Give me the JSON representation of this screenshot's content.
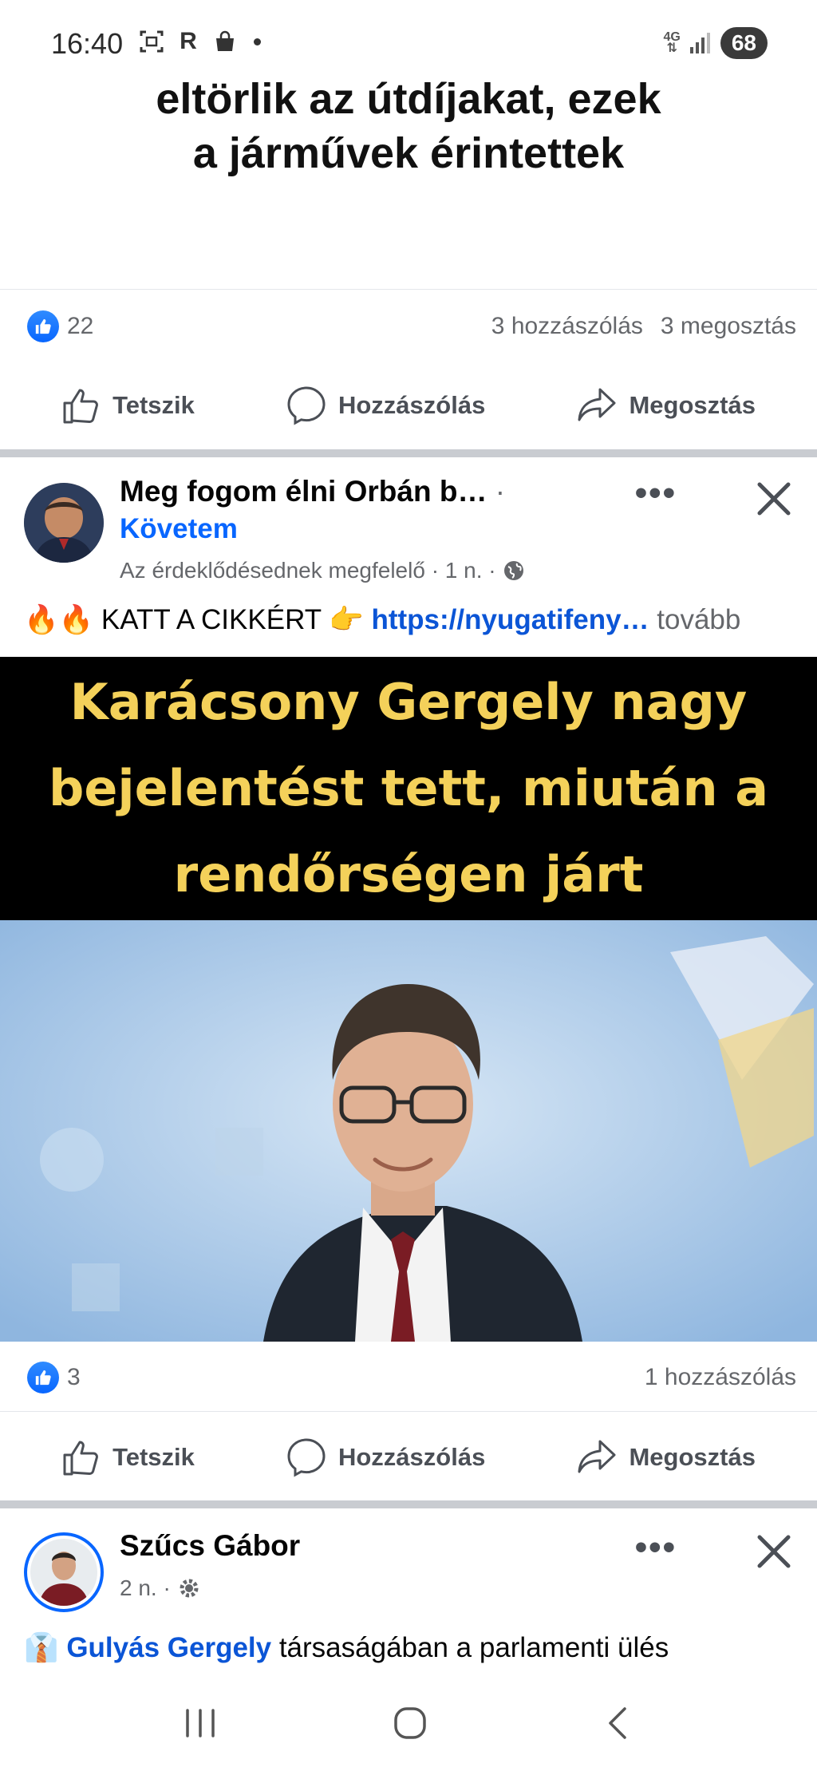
{
  "status_bar": {
    "time": "16:40",
    "network": "4G",
    "battery": "68"
  },
  "previous_post": {
    "headline_line1": "eltörlik az útdíjakat, ezek",
    "headline_line2": "a járművek érintettek",
    "like_count": "22",
    "comments": "3 hozzászólás",
    "shares": "3 megosztás"
  },
  "actions": {
    "like": "Tetszik",
    "comment": "Hozzászólás",
    "share": "Megosztás"
  },
  "post": {
    "author": "Meg fogom élni Orbán b…",
    "dot": "·",
    "follow": "Követem",
    "meta": "Az érdeklődésednek megfelelő · 1 n. ·",
    "text_prefix": "🔥🔥 KATT A CIKKÉRT 👉 ",
    "link": "https://nyugatifeny…",
    "more": " tovább",
    "image_headline_line1": "Karácsony Gergely nagy",
    "image_headline_line2": "bejelentést tett, miután a",
    "image_headline_line3": "rendőrségen járt",
    "like_count": "3",
    "comments": "1 hozzászólás"
  },
  "next_post": {
    "author": "Szűcs Gábor",
    "meta": "2 n. ·",
    "text_emoji": "👔 ",
    "mention": "Gulyás Gergely",
    "text": " társaságában a parlamenti ülés"
  },
  "colors": {
    "facebook_blue": "#0866ff",
    "image_text_yellow": "#f4d15a"
  }
}
